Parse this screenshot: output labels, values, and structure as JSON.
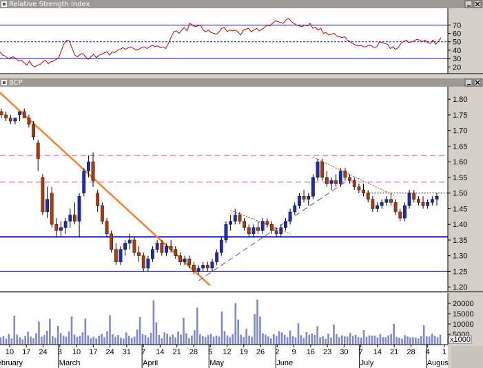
{
  "panels": {
    "rsi_title": "Relative Strength Index",
    "price_title": "BCP",
    "volume_multiplier": "x1000"
  },
  "colors": {
    "rsi_line": "#c00000",
    "candle_up": "#1e2bb0",
    "candle_down": "#a83a0c",
    "volume_bar": "#8088c8",
    "downtrend": "#ff7f27",
    "resistance": "#e040a0",
    "support": "#1010c8",
    "dashed_trend": "#5050e0"
  },
  "chart_data": [
    {
      "type": "line",
      "title": "Relative Strength Index",
      "ylim": [
        12,
        90
      ],
      "yticks": [
        20,
        30,
        40,
        50,
        60,
        70
      ],
      "reference_lines": [
        30,
        50,
        70
      ],
      "grid": false,
      "series": [
        {
          "values": [
            38,
            34,
            33,
            30,
            31,
            32,
            30,
            27,
            28,
            25,
            22,
            27,
            22,
            20,
            22,
            23,
            26,
            28,
            24,
            26,
            27,
            29,
            31,
            40,
            48,
            52,
            51,
            42,
            34,
            32,
            35,
            36,
            32,
            29,
            32,
            35,
            31,
            34,
            35,
            37,
            38,
            34,
            38,
            37,
            40,
            41,
            43,
            41,
            43,
            44,
            42,
            40,
            41,
            43,
            44,
            42,
            44,
            46,
            44,
            45,
            43,
            44,
            42,
            48,
            55,
            62,
            63,
            60,
            64,
            67,
            63,
            72,
            70,
            68,
            69,
            70,
            64,
            62,
            64,
            61,
            60,
            59,
            62,
            66,
            67,
            62,
            64,
            63,
            64,
            62,
            58,
            64,
            65,
            66,
            62,
            64,
            66,
            63,
            65,
            67,
            70,
            69,
            72,
            75,
            74,
            73,
            72,
            76,
            78,
            74,
            72,
            70,
            69,
            68,
            70,
            69,
            72,
            66,
            67,
            64,
            66,
            60,
            61,
            58,
            59,
            60,
            57,
            56,
            55,
            56,
            52,
            50,
            48,
            46,
            45,
            46,
            44,
            44,
            46,
            45,
            43,
            44,
            50,
            49,
            48,
            47,
            42,
            44,
            41,
            43,
            48,
            50,
            52,
            49,
            50,
            51,
            53,
            52,
            50,
            52,
            49,
            48,
            52,
            47,
            50,
            55
          ]
        }
      ]
    },
    {
      "type": "candlestick",
      "title": "BCP",
      "ylim": [
        1.185,
        1.84
      ],
      "yticks": [
        1.2,
        1.25,
        1.3,
        1.35,
        1.4,
        1.45,
        1.5,
        1.55,
        1.6,
        1.65,
        1.7,
        1.75,
        1.8
      ],
      "candles": [
        [
          1.76,
          1.77,
          1.74,
          1.75
        ],
        [
          1.75,
          1.76,
          1.73,
          1.74
        ],
        [
          1.74,
          1.75,
          1.72,
          1.73
        ],
        [
          1.73,
          1.74,
          1.72,
          1.74
        ],
        [
          1.75,
          1.76,
          1.73,
          1.76
        ],
        [
          1.76,
          1.77,
          1.74,
          1.74
        ],
        [
          1.74,
          1.75,
          1.71,
          1.72
        ],
        [
          1.72,
          1.73,
          1.67,
          1.68
        ],
        [
          1.66,
          1.67,
          1.57,
          1.61
        ],
        [
          1.55,
          1.56,
          1.43,
          1.44
        ],
        [
          1.44,
          1.52,
          1.42,
          1.48
        ],
        [
          1.5,
          1.52,
          1.39,
          1.4
        ],
        [
          1.4,
          1.42,
          1.36,
          1.38
        ],
        [
          1.38,
          1.41,
          1.36,
          1.39
        ],
        [
          1.39,
          1.42,
          1.37,
          1.41
        ],
        [
          1.41,
          1.45,
          1.39,
          1.43
        ],
        [
          1.43,
          1.47,
          1.4,
          1.41
        ],
        [
          1.41,
          1.5,
          1.36,
          1.49
        ],
        [
          1.5,
          1.58,
          1.49,
          1.57
        ],
        [
          1.57,
          1.62,
          1.55,
          1.6
        ],
        [
          1.6,
          1.63,
          1.52,
          1.54
        ],
        [
          1.5,
          1.51,
          1.44,
          1.46
        ],
        [
          1.46,
          1.47,
          1.4,
          1.41
        ],
        [
          1.41,
          1.42,
          1.36,
          1.37
        ],
        [
          1.37,
          1.38,
          1.31,
          1.32
        ],
        [
          1.32,
          1.34,
          1.27,
          1.28
        ],
        [
          1.28,
          1.33,
          1.27,
          1.32
        ],
        [
          1.32,
          1.35,
          1.3,
          1.34
        ],
        [
          1.34,
          1.37,
          1.32,
          1.35
        ],
        [
          1.35,
          1.36,
          1.3,
          1.31
        ],
        [
          1.31,
          1.33,
          1.28,
          1.3
        ],
        [
          1.3,
          1.31,
          1.25,
          1.26
        ],
        [
          1.26,
          1.3,
          1.25,
          1.29
        ],
        [
          1.29,
          1.33,
          1.28,
          1.32
        ],
        [
          1.32,
          1.35,
          1.31,
          1.34
        ],
        [
          1.34,
          1.35,
          1.3,
          1.31
        ],
        [
          1.31,
          1.34,
          1.3,
          1.33
        ],
        [
          1.33,
          1.35,
          1.31,
          1.32
        ],
        [
          1.32,
          1.33,
          1.29,
          1.3
        ],
        [
          1.3,
          1.31,
          1.27,
          1.28
        ],
        [
          1.28,
          1.3,
          1.27,
          1.29
        ],
        [
          1.29,
          1.3,
          1.26,
          1.27
        ],
        [
          1.27,
          1.28,
          1.24,
          1.25
        ],
        [
          1.25,
          1.27,
          1.24,
          1.26
        ],
        [
          1.26,
          1.28,
          1.25,
          1.27
        ],
        [
          1.27,
          1.28,
          1.25,
          1.26
        ],
        [
          1.26,
          1.29,
          1.25,
          1.28
        ],
        [
          1.28,
          1.32,
          1.27,
          1.31
        ],
        [
          1.31,
          1.36,
          1.3,
          1.35
        ],
        [
          1.35,
          1.41,
          1.34,
          1.4
        ],
        [
          1.4,
          1.43,
          1.38,
          1.41
        ],
        [
          1.41,
          1.45,
          1.4,
          1.43
        ],
        [
          1.43,
          1.44,
          1.4,
          1.41
        ],
        [
          1.41,
          1.42,
          1.38,
          1.39
        ],
        [
          1.39,
          1.4,
          1.36,
          1.37
        ],
        [
          1.37,
          1.4,
          1.36,
          1.39
        ],
        [
          1.39,
          1.41,
          1.37,
          1.38
        ],
        [
          1.38,
          1.42,
          1.37,
          1.41
        ],
        [
          1.41,
          1.42,
          1.39,
          1.4
        ],
        [
          1.4,
          1.41,
          1.37,
          1.38
        ],
        [
          1.38,
          1.39,
          1.36,
          1.37
        ],
        [
          1.37,
          1.4,
          1.36,
          1.39
        ],
        [
          1.39,
          1.42,
          1.38,
          1.41
        ],
        [
          1.41,
          1.45,
          1.4,
          1.44
        ],
        [
          1.44,
          1.47,
          1.43,
          1.46
        ],
        [
          1.46,
          1.5,
          1.45,
          1.49
        ],
        [
          1.49,
          1.51,
          1.47,
          1.48
        ],
        [
          1.48,
          1.5,
          1.46,
          1.49
        ],
        [
          1.49,
          1.56,
          1.48,
          1.55
        ],
        [
          1.55,
          1.61,
          1.54,
          1.6
        ],
        [
          1.6,
          1.61,
          1.54,
          1.55
        ],
        [
          1.55,
          1.57,
          1.52,
          1.53
        ],
        [
          1.53,
          1.55,
          1.51,
          1.54
        ],
        [
          1.54,
          1.56,
          1.52,
          1.53
        ],
        [
          1.53,
          1.58,
          1.52,
          1.57
        ],
        [
          1.57,
          1.58,
          1.54,
          1.55
        ],
        [
          1.55,
          1.56,
          1.53,
          1.54
        ],
        [
          1.54,
          1.55,
          1.51,
          1.52
        ],
        [
          1.52,
          1.53,
          1.5,
          1.51
        ],
        [
          1.51,
          1.53,
          1.49,
          1.5
        ],
        [
          1.5,
          1.51,
          1.47,
          1.48
        ],
        [
          1.48,
          1.49,
          1.44,
          1.45
        ],
        [
          1.45,
          1.47,
          1.44,
          1.46
        ],
        [
          1.46,
          1.48,
          1.45,
          1.47
        ],
        [
          1.47,
          1.49,
          1.46,
          1.48
        ],
        [
          1.48,
          1.5,
          1.46,
          1.47
        ],
        [
          1.47,
          1.48,
          1.43,
          1.44
        ],
        [
          1.44,
          1.45,
          1.41,
          1.42
        ],
        [
          1.42,
          1.47,
          1.41,
          1.46
        ],
        [
          1.46,
          1.51,
          1.45,
          1.5
        ],
        [
          1.5,
          1.51,
          1.47,
          1.48
        ],
        [
          1.48,
          1.49,
          1.46,
          1.47
        ],
        [
          1.47,
          1.49,
          1.45,
          1.46
        ],
        [
          1.46,
          1.48,
          1.45,
          1.47
        ],
        [
          1.47,
          1.49,
          1.46,
          1.48
        ],
        [
          1.48,
          1.5,
          1.46,
          1.49
        ]
      ],
      "annotations": {
        "resistance_upper": 1.62,
        "resistance_lower": 1.535,
        "support": 1.36,
        "support_low": 1.25,
        "short_dotted_level": 1.5
      },
      "grid": false
    },
    {
      "type": "bar",
      "title": "",
      "ylim": [
        0,
        25000
      ],
      "yticks": [
        5000,
        10000,
        15000,
        20000
      ],
      "values": [
        3500,
        4200,
        2800,
        5100,
        3000,
        14000,
        4800,
        3600,
        2600,
        4300,
        6200,
        3900,
        3100,
        5500,
        11200,
        3800,
        4600,
        6700,
        12500,
        4100,
        3300,
        9000,
        5600,
        4400,
        3800,
        6300,
        13700,
        4900,
        3700,
        4200,
        6000,
        12600,
        4500,
        3100,
        3800,
        2900,
        4400,
        5200,
        3600,
        6500,
        14200,
        5000,
        3800,
        4700,
        3400,
        2900,
        5900,
        4300,
        3200,
        3900,
        7300,
        13400,
        5200,
        4600,
        3400,
        5700,
        21500,
        10800,
        4700,
        3100,
        6000,
        5200,
        3800,
        4900,
        3500,
        6400,
        4800,
        13000,
        5500,
        3100,
        4400,
        6900,
        17900,
        5100,
        4200,
        3600,
        4600,
        5200,
        3800,
        4400,
        3900,
        16000,
        6500,
        4500,
        3600,
        5000,
        20200,
        12100,
        4800,
        3600,
        7600,
        4400,
        3800,
        14800,
        21800,
        13600,
        5500,
        4800,
        3900,
        3000,
        5100,
        4200,
        6500,
        5900,
        4800,
        3600,
        6800,
        4100,
        3500,
        10400,
        4600,
        3200,
        6100,
        4800,
        5400,
        4700,
        8900,
        3600,
        4100,
        2800,
        5300,
        3400,
        9800,
        5100,
        3600,
        4500,
        4000,
        3900,
        5600,
        4200,
        4800,
        3700,
        3300,
        7000,
        3800,
        4500,
        4400,
        4400,
        3500,
        5100,
        3700,
        3600,
        4500,
        5100,
        10100,
        3800,
        3300,
        2800,
        4600,
        4000,
        3400,
        3600,
        3400,
        3000,
        4200,
        9300,
        4000,
        3900,
        5300,
        4300,
        3500,
        4700
      ]
    }
  ],
  "xaxis": {
    "ticks": [
      {
        "label": "10",
        "major": false
      },
      {
        "label": "17",
        "major": false
      },
      {
        "label": "24",
        "major": false
      },
      {
        "label": "3",
        "major": false
      },
      {
        "label": "10",
        "major": false
      },
      {
        "label": "17",
        "major": false
      },
      {
        "label": "24",
        "major": false
      },
      {
        "label": "31",
        "major": false
      },
      {
        "label": "7",
        "major": false
      },
      {
        "label": "14",
        "major": false
      },
      {
        "label": "21",
        "major": false
      },
      {
        "label": "28",
        "major": false
      },
      {
        "label": "5",
        "major": false
      },
      {
        "label": "12",
        "major": false
      },
      {
        "label": "19",
        "major": false
      },
      {
        "label": "26",
        "major": false
      },
      {
        "label": "2",
        "major": false
      },
      {
        "label": "9",
        "major": false
      },
      {
        "label": "16",
        "major": false
      },
      {
        "label": "23",
        "major": false
      },
      {
        "label": "30",
        "major": false
      },
      {
        "label": "7",
        "major": false
      },
      {
        "label": "14",
        "major": false
      },
      {
        "label": "21",
        "major": false
      },
      {
        "label": "28",
        "major": false
      },
      {
        "label": "4",
        "major": false
      },
      {
        "label": "1",
        "major": false
      }
    ],
    "months": [
      "February",
      "March",
      "April",
      "May",
      "June",
      "July",
      "August"
    ]
  }
}
